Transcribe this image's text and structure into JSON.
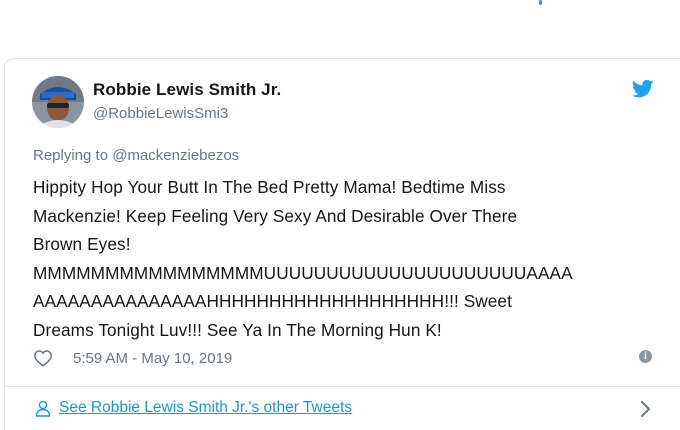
{
  "tweet": {
    "author_name": "Robbie Lewis Smith Jr.",
    "author_handle": "@RobbieLewisSmi3",
    "reply_context": "Replying to @mackenziebezos",
    "text": "Hippity Hop Your Butt In The Bed Pretty Mama! Bedtime Miss\nMackenzie! Keep Feeling Very Sexy And Desirable Over There\nBrown Eyes!\nMMMMMMMMMMMMMMMMUUUUUUUUUUUUUUUUUUUUUAAAA\nAAAAAAAAAAAAAAAHHHHHHHHHHHHHHHHHHH!!! Sweet\nDreams Tonight Luv!!! See Ya In The Morning Hun K!",
    "timestamp": "5:59 AM - May 10, 2019",
    "info_glyph": "i",
    "other_tweets_link": "See Robbie Lewis Smith Jr.'s other Tweets"
  },
  "icons": {
    "bird": "twitter-bird-icon",
    "heart": "heart-icon",
    "info": "info-icon",
    "person": "person-icon",
    "chevron": "chevron-right-icon"
  },
  "colors": {
    "text": "#14171a",
    "secondary": "#657786",
    "link": "#1b95e0",
    "brand": "#1da1f2",
    "border": "#e1e8ed"
  }
}
